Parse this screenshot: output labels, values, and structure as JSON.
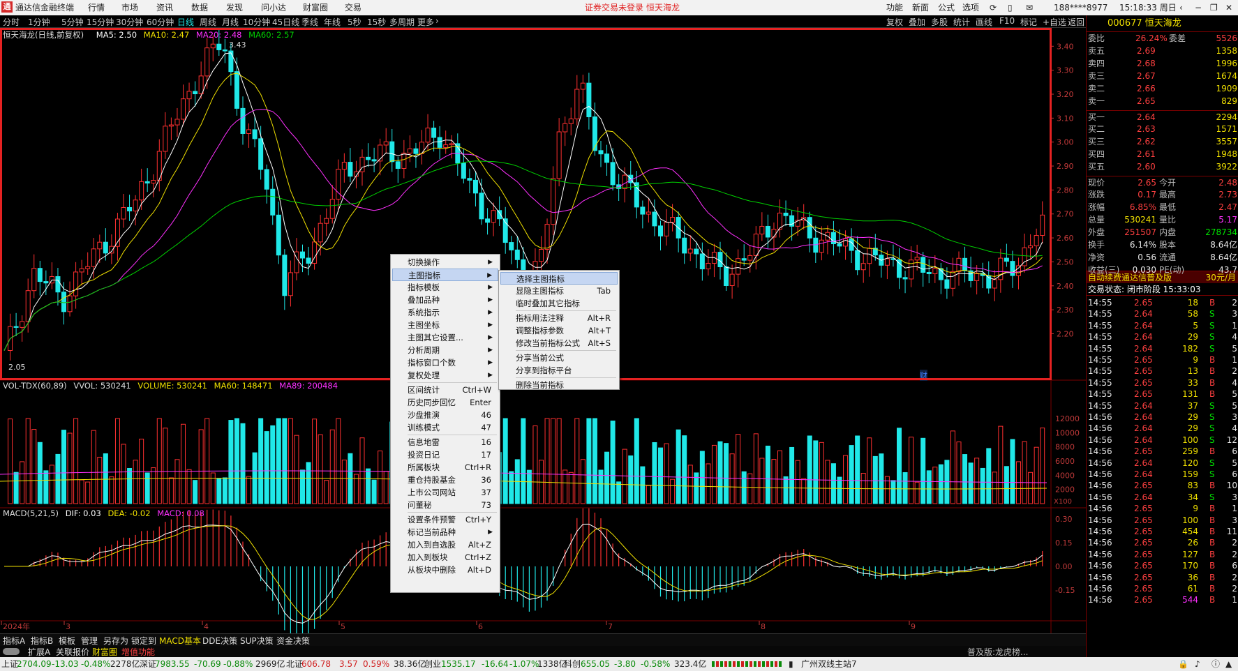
{
  "titlebar": {
    "app_name": "通达信金融终端",
    "menus": [
      "行情",
      "市场",
      "资讯",
      "数据",
      "发现",
      "问小达",
      "财富圈",
      "交易"
    ],
    "notice": "证券交易未登录",
    "stock_short": "恒天海龙",
    "right_menus": [
      "功能",
      "新面",
      "公式",
      "选项"
    ],
    "account": "188****8977",
    "time": "15:18:33 周日"
  },
  "periodbar": {
    "periods": [
      "分时",
      "1分钟",
      "5分钟",
      "15分钟",
      "30分钟",
      "60分钟",
      "日线",
      "周线",
      "月线",
      "10分钟",
      "45日线",
      "季线",
      "年线",
      "5秒",
      "15秒",
      "多周期",
      "更多"
    ],
    "active": "日线",
    "right_tools": [
      "复权",
      "叠加",
      "多股",
      "统计",
      "画线",
      "F10",
      "标记",
      "+自选",
      "返回"
    ]
  },
  "main_chart": {
    "legend_name": "恒天海龙(日线,前复权)",
    "ma5": "MA5: 2.50",
    "ma10": "MA10: 2.47",
    "ma20": "MA20: 2.48",
    "ma60": "MA60: 2.57",
    "high_label": "3.43",
    "low_label": "2.05",
    "price_ticks": [
      "3.40",
      "3.30",
      "3.20",
      "3.10",
      "3.00",
      "2.90",
      "2.80",
      "2.70",
      "2.60",
      "2.50",
      "2.40",
      "2.30",
      "2.20"
    ],
    "finance_marker": "财"
  },
  "volume_chart": {
    "legend": "VOL-TDX(60,89)",
    "vvol": "VVOL: 530241",
    "volume": "VOLUME: 530241",
    "ma60": "MA60: 148471",
    "ma89": "MA89: 200484",
    "ticks": [
      "12000",
      "10000",
      "8000",
      "6000",
      "4000",
      "2000"
    ],
    "unit": "X100"
  },
  "macd_chart": {
    "legend": "MACD(5,21,5)",
    "dif": "DIF: 0.03",
    "dea": "DEA: -0.02",
    "macd": "MACD: 0.08",
    "ticks": [
      "0.30",
      "0.15",
      "0.00",
      "-0.15"
    ]
  },
  "x_axis": [
    "2024年",
    "3",
    "4",
    "5",
    "6",
    "7",
    "8",
    "9"
  ],
  "context_menu": {
    "items": [
      {
        "label": "切换操作",
        "key": "",
        "arrow": true
      },
      {
        "label": "主图指标",
        "key": "",
        "arrow": true,
        "active": true
      },
      {
        "label": "指标模板",
        "key": "",
        "arrow": true
      },
      {
        "label": "叠加品种",
        "key": "",
        "arrow": true
      },
      {
        "label": "系统指示",
        "key": "",
        "arrow": true
      },
      {
        "label": "主图坐标",
        "key": "",
        "arrow": true
      },
      {
        "label": "主图其它设置...",
        "key": "",
        "arrow": true
      },
      {
        "label": "分析周期",
        "key": "",
        "arrow": true
      },
      {
        "label": "指标窗口个数",
        "key": "",
        "arrow": true
      },
      {
        "label": "复权处理",
        "key": "",
        "arrow": true
      },
      {
        "label": "区间统计",
        "key": "Ctrl+W",
        "arrow": false
      },
      {
        "label": "历史同步回忆",
        "key": "Enter",
        "arrow": false
      },
      {
        "label": "沙盘推演",
        "key": "46",
        "arrow": false
      },
      {
        "label": "训练模式",
        "key": "47",
        "arrow": false
      },
      {
        "label": "信息地雷",
        "key": "16",
        "arrow": false
      },
      {
        "label": "投资日记",
        "key": "17",
        "arrow": false
      },
      {
        "label": "所属板块",
        "key": "Ctrl+R",
        "arrow": false
      },
      {
        "label": "重仓持股基金",
        "key": "36",
        "arrow": false
      },
      {
        "label": "上市公司网站",
        "key": "37",
        "arrow": false
      },
      {
        "label": "问董秘",
        "key": "73",
        "arrow": false
      },
      {
        "label": "设置条件预警",
        "key": "Ctrl+Y",
        "arrow": false
      },
      {
        "label": "标记当前品种",
        "key": "",
        "arrow": true
      },
      {
        "label": "加入到自选股",
        "key": "Alt+Z",
        "arrow": false
      },
      {
        "label": "加入到板块",
        "key": "Ctrl+Z",
        "arrow": false
      },
      {
        "label": "从板块中删除",
        "key": "Alt+D",
        "arrow": false
      }
    ],
    "submenu": [
      {
        "label": "选择主图指标",
        "key": "",
        "active": true
      },
      {
        "label": "显隐主图指标",
        "key": "Tab"
      },
      {
        "label": "临时叠加其它指标",
        "key": ""
      },
      {
        "label": "指标用法注释",
        "key": "Alt+R"
      },
      {
        "label": "调整指标参数",
        "key": "Alt+T"
      },
      {
        "label": "修改当前指标公式",
        "key": "Alt+S"
      },
      {
        "label": "分享当前公式",
        "key": ""
      },
      {
        "label": "分享到指标平台",
        "key": ""
      },
      {
        "label": "删除当前指标",
        "key": ""
      }
    ]
  },
  "quote_panel": {
    "code_name": "000677 恒天海龙",
    "weibi_label": "委比",
    "weibi": "26.24%",
    "weicha_label": "委差",
    "weicha": "5526",
    "asks": [
      {
        "label": "卖五",
        "price": "2.69",
        "vol": "1358"
      },
      {
        "label": "卖四",
        "price": "2.68",
        "vol": "1996"
      },
      {
        "label": "卖三",
        "price": "2.67",
        "vol": "1674"
      },
      {
        "label": "卖二",
        "price": "2.66",
        "vol": "1909"
      },
      {
        "label": "卖一",
        "price": "2.65",
        "vol": "829"
      }
    ],
    "bids": [
      {
        "label": "买一",
        "price": "2.64",
        "vol": "2294"
      },
      {
        "label": "买二",
        "price": "2.63",
        "vol": "1571"
      },
      {
        "label": "买三",
        "price": "2.62",
        "vol": "3557"
      },
      {
        "label": "买四",
        "price": "2.61",
        "vol": "1948"
      },
      {
        "label": "买五",
        "price": "2.60",
        "vol": "3922"
      }
    ],
    "stats": [
      {
        "l1": "现价",
        "v1": "2.65",
        "l2": "今开",
        "v2": "2.48"
      },
      {
        "l1": "涨跌",
        "v1": "0.17",
        "l2": "最高",
        "v2": "2.73"
      },
      {
        "l1": "涨幅",
        "v1": "6.85%",
        "l2": "最低",
        "v2": "2.47"
      },
      {
        "l1": "总量",
        "v1": "530241",
        "l2": "量比",
        "v2": "5.17"
      },
      {
        "l1": "外盘",
        "v1": "251507",
        "l2": "内盘",
        "v2": "278734"
      },
      {
        "l1": "换手",
        "v1": "6.14%",
        "l2": "股本",
        "v2": "8.64亿"
      },
      {
        "l1": "净资",
        "v1": "0.56",
        "l2": "流通",
        "v2": "8.64亿"
      },
      {
        "l1": "收益(三)",
        "v1": "0.030",
        "l2": "PE(动)",
        "v2": "43.7"
      }
    ],
    "promo": "自动续费通达信普及版",
    "promo_price": "30元/月",
    "trade_status": "交易状态: 闭市阶段 15:33:03",
    "ticks": [
      {
        "t": "14:55",
        "p": "2.65",
        "v": "18",
        "d": "B",
        "n": "2"
      },
      {
        "t": "14:55",
        "p": "2.64",
        "v": "58",
        "d": "S",
        "n": "3"
      },
      {
        "t": "14:55",
        "p": "2.64",
        "v": "5",
        "d": "S",
        "n": "1"
      },
      {
        "t": "14:55",
        "p": "2.64",
        "v": "29",
        "d": "S",
        "n": "4"
      },
      {
        "t": "14:55",
        "p": "2.64",
        "v": "182",
        "d": "S",
        "n": "5"
      },
      {
        "t": "14:55",
        "p": "2.65",
        "v": "9",
        "d": "B",
        "n": "1"
      },
      {
        "t": "14:55",
        "p": "2.65",
        "v": "13",
        "d": "B",
        "n": "2"
      },
      {
        "t": "14:55",
        "p": "2.65",
        "v": "33",
        "d": "B",
        "n": "4"
      },
      {
        "t": "14:55",
        "p": "2.65",
        "v": "131",
        "d": "B",
        "n": "5"
      },
      {
        "t": "14:55",
        "p": "2.64",
        "v": "37",
        "d": "S",
        "n": "5"
      },
      {
        "t": "14:56",
        "p": "2.64",
        "v": "29",
        "d": "S",
        "n": "3"
      },
      {
        "t": "14:56",
        "p": "2.64",
        "v": "29",
        "d": "S",
        "n": "4"
      },
      {
        "t": "14:56",
        "p": "2.64",
        "v": "100",
        "d": "S",
        "n": "12"
      },
      {
        "t": "14:56",
        "p": "2.65",
        "v": "259",
        "d": "B",
        "n": "6"
      },
      {
        "t": "14:56",
        "p": "2.64",
        "v": "120",
        "d": "S",
        "n": "5"
      },
      {
        "t": "14:56",
        "p": "2.64",
        "v": "159",
        "d": "S",
        "n": "6"
      },
      {
        "t": "14:56",
        "p": "2.65",
        "v": "83",
        "d": "B",
        "n": "10"
      },
      {
        "t": "14:56",
        "p": "2.64",
        "v": "34",
        "d": "S",
        "n": "3"
      },
      {
        "t": "14:56",
        "p": "2.65",
        "v": "9",
        "d": "B",
        "n": "1"
      },
      {
        "t": "14:56",
        "p": "2.65",
        "v": "100",
        "d": "B",
        "n": "3"
      },
      {
        "t": "14:56",
        "p": "2.65",
        "v": "454",
        "d": "B",
        "n": "11"
      },
      {
        "t": "14:56",
        "p": "2.65",
        "v": "26",
        "d": "B",
        "n": "2"
      },
      {
        "t": "14:56",
        "p": "2.65",
        "v": "127",
        "d": "B",
        "n": "2"
      },
      {
        "t": "14:56",
        "p": "2.65",
        "v": "170",
        "d": "B",
        "n": "6"
      },
      {
        "t": "14:56",
        "p": "2.65",
        "v": "36",
        "d": "B",
        "n": "2"
      },
      {
        "t": "14:56",
        "p": "2.65",
        "v": "61",
        "d": "B",
        "n": "2"
      },
      {
        "t": "14:56",
        "p": "2.65",
        "v": "544",
        "d": "B",
        "n": "1"
      }
    ]
  },
  "bottom_tabs": [
    "指标A",
    "指标B",
    "模板",
    "管理",
    "另存为",
    "锁定到",
    "MACD基本",
    "DDE决策",
    "SUP决策",
    "资金决策"
  ],
  "bottom_active": "MACD基本",
  "sub_tabs": [
    "扩展A",
    "关联报价",
    "财富圈",
    "增值功能"
  ],
  "status_bar": {
    "sh_label": "上证",
    "sh": "2704.09",
    "sh_chg": "-13.03",
    "sh_pct": "-0.48%",
    "sh_amt": "2278亿",
    "sz_label": "深证",
    "sz": "7983.55",
    "sz_chg": "-70.69",
    "sz_pct": "-0.88%",
    "sz_amt": "2969亿",
    "bz_label": "北证",
    "bz": "606.78",
    "bz_chg": "3.57",
    "bz_pct": "0.59%",
    "bz_amt": "38.36亿",
    "cy_label": "创业",
    "cy": "1535.17",
    "cy_chg": "-16.64",
    "cy_pct": "-1.07%",
    "cy_amt": "1338亿",
    "kc_label": "科创",
    "kc": "655.05",
    "kc_chg": "-3.80",
    "kc_pct": "-0.58%",
    "kc_amt": "323.4亿",
    "server": "广州双线主站7",
    "hint": "普及版:龙虎榜..."
  },
  "colors": {
    "up": "#ff3030",
    "down": "#20e8e8",
    "frame": "#e52222",
    "ma5": "#ffffff",
    "ma10": "#f0e000",
    "ma20": "#ff30ff",
    "ma60": "#00d000"
  }
}
